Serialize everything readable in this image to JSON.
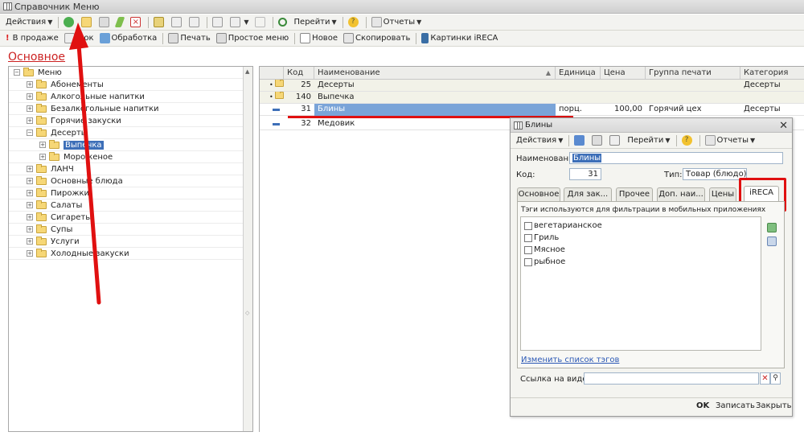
{
  "window": {
    "title": "Справочник Меню"
  },
  "toolbar1": {
    "actions": "Действия",
    "goto": "Перейти",
    "reports": "Отчеты"
  },
  "toolbar2": {
    "on_sale": "В продаже",
    "hidden_item": "...ок",
    "processing": "Обработка",
    "print": "Печать",
    "simple_menu": "Простое меню",
    "new": "Новое",
    "copy": "Скопировать",
    "ireca_pictures": "Картинки iRECA"
  },
  "section": {
    "title": "Основное"
  },
  "tree": {
    "root": "Меню",
    "items": [
      "Абонементы",
      "Алкогольные напитки",
      "Безалкогольные напитки",
      "Горячие закуски",
      "Десерты",
      "Выпечка",
      "Мороженое",
      "ЛАНЧ",
      "Основные блюда",
      "Пирожки",
      "Салаты",
      "Сигареты",
      "Супы",
      "Услуги",
      "Холодные закуски"
    ]
  },
  "grid": {
    "columns": [
      "Код",
      "Наименование",
      "Единица",
      "Цена",
      "Группа печати",
      "Категория"
    ],
    "rows": [
      {
        "code": "25",
        "name": "Десерты",
        "unit": "",
        "price": "",
        "print_group": "",
        "category": "Десерты"
      },
      {
        "code": "140",
        "name": "Выпечка",
        "unit": "",
        "price": "",
        "print_group": "",
        "category": ""
      },
      {
        "code": "31",
        "name": "Блины",
        "unit": "порц.",
        "price": "100,00",
        "print_group": "Горячий цех",
        "category": "Десерты"
      },
      {
        "code": "32",
        "name": "Медовик",
        "unit": "",
        "price": "",
        "print_group": "",
        "category": ""
      }
    ]
  },
  "dialog": {
    "title": "Блины",
    "toolbar": {
      "actions": "Действия",
      "goto": "Перейти",
      "reports": "Отчеты"
    },
    "name_label": "Наименование:",
    "name_value": "Блины",
    "code_label": "Код:",
    "code_value": "31",
    "type_label": "Тип:",
    "type_value": "Товар (блюдо)",
    "tabs": [
      "Основное",
      "Для зак...",
      "Прочее",
      "Доп. наи...",
      "Цены",
      "iRECA"
    ],
    "tags_hint": "Тэги используются для фильтрации в мобильных приложениях",
    "tags": [
      "вегетарианское",
      "Гриль",
      "Мясное",
      "рыбное"
    ],
    "edit_tags_link": "Изменить список тэгов",
    "video_label": "Ссылка на видео:",
    "video_value": "",
    "ok": "OK",
    "save": "Записать",
    "close": "Закрыть"
  },
  "colors": {
    "accent_red": "#e01010",
    "selection": "#3d6fb8",
    "folder": "#f6d777"
  }
}
